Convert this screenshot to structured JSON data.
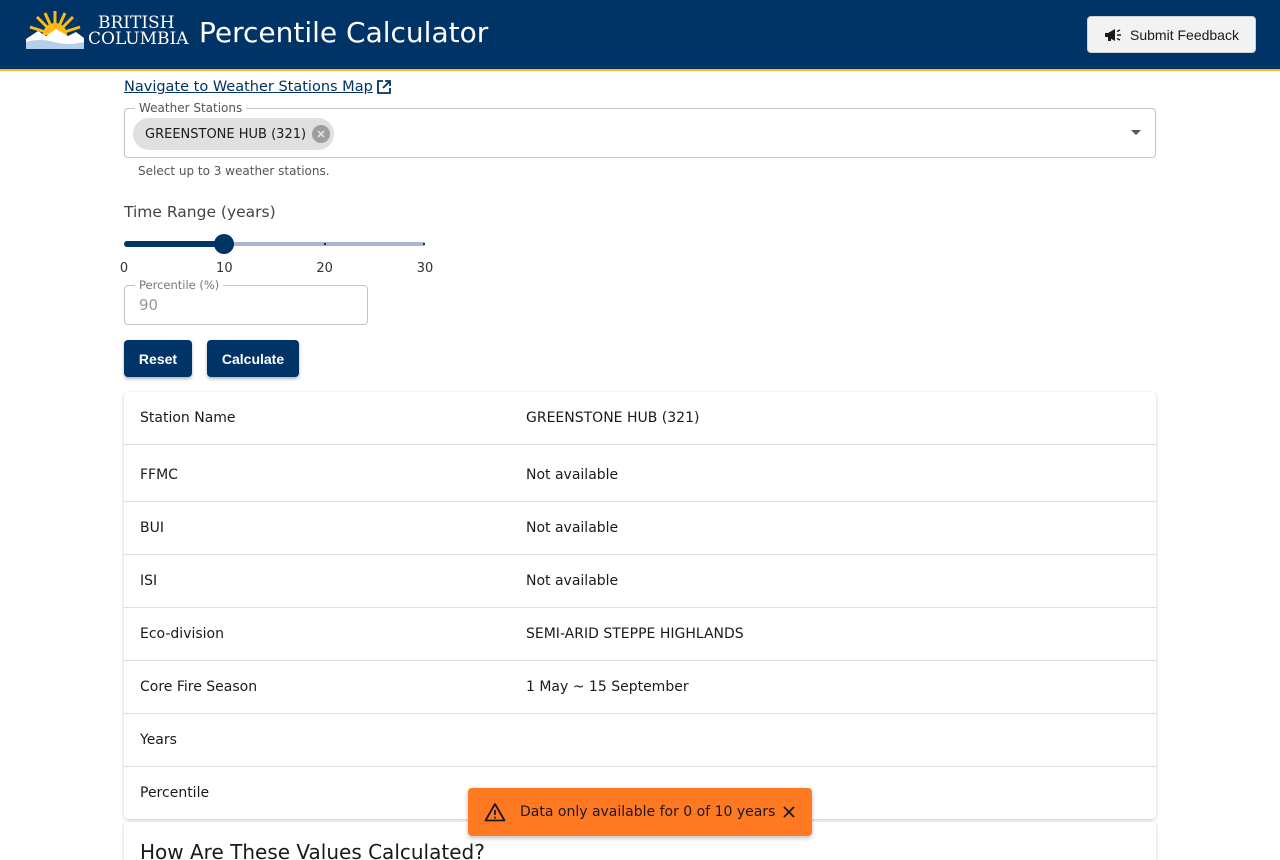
{
  "header": {
    "logo_line1": "BRITISH",
    "logo_line2": "COLUMBIA",
    "title": "Percentile Calculator",
    "feedback_label": "Submit Feedback"
  },
  "nav_link": "Navigate to Weather Stations Map",
  "stations": {
    "label": "Weather Stations",
    "selected": "GREENSTONE HUB (321)",
    "helper": "Select up to 3 weather stations."
  },
  "time_range": {
    "label": "Time Range (years)",
    "min": 0,
    "max": 30,
    "value": 10,
    "marks": [
      "0",
      "10",
      "20",
      "30"
    ]
  },
  "percentile": {
    "label": "Percentile (%)",
    "value": "90"
  },
  "buttons": {
    "reset": "Reset",
    "calculate": "Calculate"
  },
  "table": {
    "rows": [
      {
        "name": "Station Name",
        "value": "GREENSTONE HUB (321)"
      },
      {
        "name": "FFMC",
        "value": "Not available"
      },
      {
        "name": "BUI",
        "value": "Not available"
      },
      {
        "name": "ISI",
        "value": "Not available"
      },
      {
        "name": "Eco-division",
        "value": "SEMI-ARID STEPPE HIGHLANDS"
      },
      {
        "name": "Core Fire Season",
        "value": "1 May ~ 15 September"
      },
      {
        "name": "Years",
        "value": ""
      },
      {
        "name": "Percentile",
        "value": ""
      }
    ]
  },
  "how": {
    "title": "How Are These Values Calculated?"
  },
  "snackbar": {
    "message": "Data only available for 0 of 10 years"
  },
  "colors": {
    "primary": "#003366",
    "accent": "#fcba19",
    "warning": "#fe7921"
  }
}
